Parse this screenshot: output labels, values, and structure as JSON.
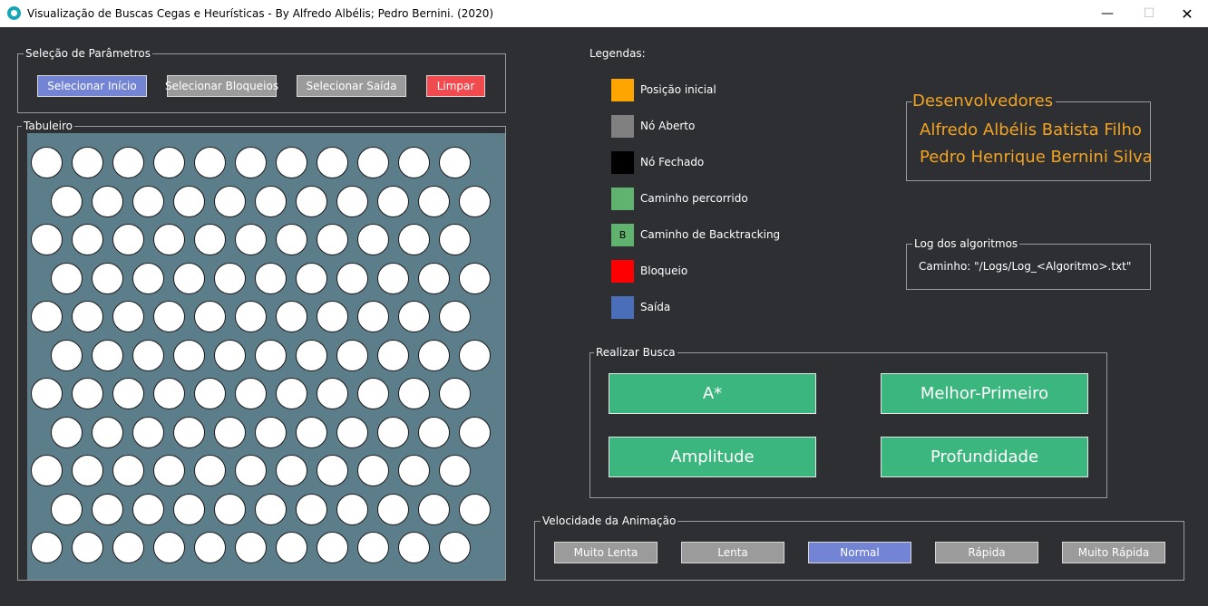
{
  "window": {
    "title": "Visualização de Buscas Cegas e Heurísticas - By Alfredo Albélis; Pedro Bernini. (2020)",
    "minimize": "—",
    "maximize": "☐",
    "close": "✕"
  },
  "params": {
    "label": "Seleção de Parâmetros",
    "select_start": "Selecionar Início",
    "select_blocks": "Selecionar Bloqueios",
    "select_exit": "Selecionar Saída",
    "clear": "Limpar"
  },
  "board": {
    "label": "Tabuleiro",
    "rows": [
      11,
      11,
      11,
      11,
      11,
      11,
      11,
      11,
      11,
      11,
      11
    ]
  },
  "legend": {
    "title": "Legendas:",
    "items": [
      {
        "label": "Posição inicial",
        "color": "#ffa500",
        "mark": ""
      },
      {
        "label": "Nó Aberto",
        "color": "#808080",
        "mark": ""
      },
      {
        "label": "Nó Fechado",
        "color": "#000000",
        "mark": ""
      },
      {
        "label": "Caminho percorrido",
        "color": "#5fb36f",
        "mark": ""
      },
      {
        "label": "Caminho de Backtracking",
        "color": "#5fb36f",
        "mark": "B"
      },
      {
        "label": "Bloqueio",
        "color": "#ff0000",
        "mark": ""
      },
      {
        "label": "Saída",
        "color": "#4a6fb8",
        "mark": ""
      }
    ]
  },
  "developers": {
    "title": "Desenvolvedores",
    "names": [
      "Alfredo Albélis Batista Filho",
      "Pedro Henrique Bernini Silva"
    ]
  },
  "log": {
    "label": "Log dos algoritmos",
    "path": "Caminho: \"/Logs/Log_<Algoritmo>.txt\""
  },
  "search": {
    "label": "Realizar Busca",
    "a_star": "A*",
    "best_first": "Melhor-Primeiro",
    "breadth": "Amplitude",
    "depth": "Profundidade"
  },
  "speed": {
    "label": "Velocidade da Animação",
    "options": [
      "Muito Lenta",
      "Lenta",
      "Normal",
      "Rápida",
      "Muito Rápida"
    ],
    "selected": "Normal"
  },
  "colors": {
    "background": "#2d2f33",
    "selected_button": "#7384d4",
    "neutral_button": "#9b9b9b",
    "clear_button": "#f24b4f",
    "search_button": "#3cb67f",
    "developer_text": "#f3a321",
    "board": "#5c7d8a"
  }
}
